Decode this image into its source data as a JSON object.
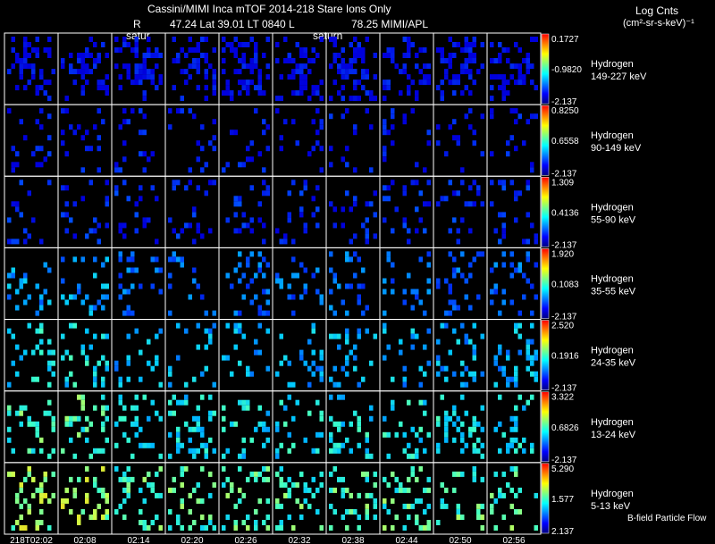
{
  "header": {
    "title": "Cassini/MIMI Inca mTOF  2014-218   Stare   Ions Only",
    "r_label": "R",
    "position": "47.24 Lat 39.01 LT 0840 L",
    "l_value": "78.25  MIMI/APL",
    "units_line1": "Log Cnts",
    "units_line2": "(cm²-sr-s-keV)⁻¹",
    "saturn_labels": [
      "satur",
      "saturn"
    ]
  },
  "colors": {
    "background": "#000000",
    "frame": "#ffffff",
    "colorbar": [
      "#ff0000",
      "#ff8000",
      "#ffff00",
      "#80ff80",
      "#00ffff",
      "#0080ff",
      "#0000ff",
      "#000080"
    ]
  },
  "chart_data": {
    "type": "heatmap",
    "description_note": "",
    "time_labels": [
      "218T02:02",
      "02:08",
      "02:14",
      "02:20",
      "02:26",
      "02:32",
      "02:38",
      "02:44",
      "02:50",
      "02:56"
    ],
    "rows": [
      {
        "species": "Hydrogen",
        "energy": "149-227 keV",
        "cb_max": "0.1727",
        "cb_mid": "-0.9820",
        "cb_min": "-2.137",
        "level": 0.0
      },
      {
        "species": "Hydrogen",
        "energy": "90-149 keV",
        "cb_max": "0.8250",
        "cb_mid": "0.6558",
        "cb_min": "-2.137",
        "level": 0.03
      },
      {
        "species": "Hydrogen",
        "energy": "55-90 keV",
        "cb_max": "1.309",
        "cb_mid": "0.4136",
        "cb_min": "-2.137",
        "level": 0.08
      },
      {
        "species": "Hydrogen",
        "energy": "35-55 keV",
        "cb_max": "1.920",
        "cb_mid": "0.1083",
        "cb_min": "-2.137",
        "level": 0.22
      },
      {
        "species": "Hydrogen",
        "energy": "24-35 keV",
        "cb_max": "2.520",
        "cb_mid": "0.1916",
        "cb_min": "-2.137",
        "level": 0.35
      },
      {
        "species": "Hydrogen",
        "energy": "13-24 keV",
        "cb_max": "3.322",
        "cb_mid": "0.6826",
        "cb_min": "-2.137",
        "level": 0.45
      },
      {
        "species": "Hydrogen",
        "energy": "5-13 keV",
        "cb_max": "5.290",
        "cb_mid": "1.577",
        "cb_min": "2.137",
        "level": 0.55
      }
    ],
    "bottom_annotation": "B-field Particle Flow"
  }
}
